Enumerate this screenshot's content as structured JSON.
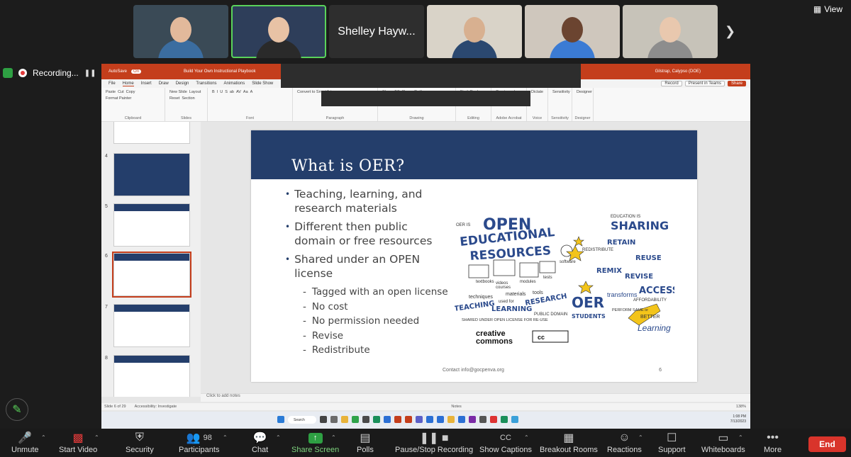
{
  "gallery": {
    "tiles": [
      {
        "type": "video",
        "skin": "#e2b99b",
        "shirt": "#3b6da0",
        "bg": "#3a4a56"
      },
      {
        "type": "video",
        "skin": "#e8c2a5",
        "shirt": "#2a2a2a",
        "bg": "#2e3e5a"
      },
      {
        "type": "name",
        "label": "Shelley Hayw..."
      },
      {
        "type": "video",
        "skin": "#d8b090",
        "shirt": "#2b4870",
        "bg": "#d9d3c8"
      },
      {
        "type": "video",
        "skin": "#6b4430",
        "shirt": "#3b7bd4",
        "bg": "#cfc7bd"
      },
      {
        "type": "video",
        "skin": "#e9c8ae",
        "shirt": "#8d8d8d",
        "bg": "#c7c3b9"
      }
    ],
    "view_label": "View"
  },
  "recording": {
    "label": "Recording..."
  },
  "powerpoint": {
    "autosave": "AutoSave",
    "autosave_state": "On",
    "doc_title": "Build Your Own Instructional Playbook",
    "user": "Gilstrap, Calypso (DOE)",
    "menu": [
      "File",
      "Home",
      "Insert",
      "Draw",
      "Design",
      "Transitions",
      "Animations",
      "Slide Show"
    ],
    "menu_right": [
      "Record",
      "Present in Teams",
      "Share"
    ],
    "ribbon_groups": [
      {
        "label": "Clipboard",
        "items": [
          "Paste",
          "Cut",
          "Copy",
          "Format Painter"
        ]
      },
      {
        "label": "Slides",
        "items": [
          "New Slide",
          "Layout",
          "Reset",
          "Section"
        ]
      },
      {
        "label": "Font",
        "items": [
          "B",
          "I",
          "U",
          "S",
          "ab",
          "AV",
          "Aa",
          "A"
        ]
      },
      {
        "label": "Paragraph",
        "items": [
          "Convert to SmartArt"
        ]
      },
      {
        "label": "Drawing",
        "items": [
          "Shape Fill",
          "Shape Outline",
          "Shape Effects",
          "Styles",
          "Arrange"
        ]
      },
      {
        "label": "Editing",
        "items": [
          "Find",
          "Replace",
          "Select"
        ]
      },
      {
        "label": "Adobe Acrobat",
        "items": [
          "Create and Share Adobe PDF"
        ]
      },
      {
        "label": "Voice",
        "items": [
          "Dictate"
        ]
      },
      {
        "label": "Sensitivity",
        "items": [
          "Sensitivity"
        ]
      },
      {
        "label": "Designer",
        "items": [
          "Designer"
        ]
      }
    ],
    "thumb_numbers": [
      "4",
      "5",
      "6",
      "7",
      "8"
    ],
    "slide": {
      "title": "What is OER?",
      "bullets": [
        "Teaching, learning, and research materials",
        "Different then public domain or free resources",
        "Shared under an OPEN license"
      ],
      "subbullets": [
        "Tagged with an open license",
        "No cost",
        "No permission needed",
        "Revise",
        "Redistribute"
      ],
      "footer": "Contact info@gocpenva.org",
      "page": "6",
      "art": {
        "open": "OPEN",
        "educational": "EDUCATIONAL",
        "resources": "RESOURCES",
        "sharing": "SHARING",
        "education_is": "EDUCATION IS",
        "retain": "RETAIN",
        "reuse": "REUSE",
        "redistribute": "REDISTRIBUTE",
        "remix": "REMIX",
        "revise": "REVISE",
        "access": "ACCESS",
        "affordability": "AFFORDABILITY",
        "oer": "OER",
        "transforms": "transforms",
        "students": "STUDENTS",
        "learning": "Learning",
        "better": "BETTER",
        "perform_same": "PERFORM SAME or",
        "creative": "creative",
        "commons": "commons",
        "cc": "cc",
        "teaching": "TEACHING",
        "learning_lbl": "LEARNING",
        "research": "RESEARCH",
        "shared_under": "SHARED UNDER OPEN LICENSE FOR RE-USE",
        "public_domain": "PUBLIC DOMAIN",
        "textbooks": "textbooks",
        "videos": "videos",
        "courses": "courses",
        "modules": "modules",
        "tests": "tests",
        "software": "software",
        "materials": "materials",
        "tools": "tools",
        "techniques": "techniques",
        "used_for": "used for",
        "oer_is": "OER IS"
      }
    },
    "notes_placeholder": "Click to add notes",
    "status_slide": "Slide 6 of 29",
    "status_access": "Accessibility: Investigate",
    "status_notes": "Notes",
    "status_zoom": "138%",
    "taskbar_search": "Search",
    "clock_time": "1:08 PM",
    "clock_date": "7/13/2023"
  },
  "toolbar": {
    "unmute": "Unmute",
    "start_video": "Start Video",
    "security": "Security",
    "participants": "Participants",
    "participants_count": "98",
    "chat": "Chat",
    "share_screen": "Share Screen",
    "polls": "Polls",
    "pause_stop": "Pause/Stop Recording",
    "captions": "Show Captions",
    "breakout": "Breakout Rooms",
    "reactions": "Reactions",
    "support": "Support",
    "whiteboards": "Whiteboards",
    "more": "More",
    "end": "End"
  },
  "colors": {
    "ppt_red": "#c43e1c",
    "slide_blue": "#243e6b",
    "share_green": "#2ea043",
    "end_red": "#d9342b"
  }
}
